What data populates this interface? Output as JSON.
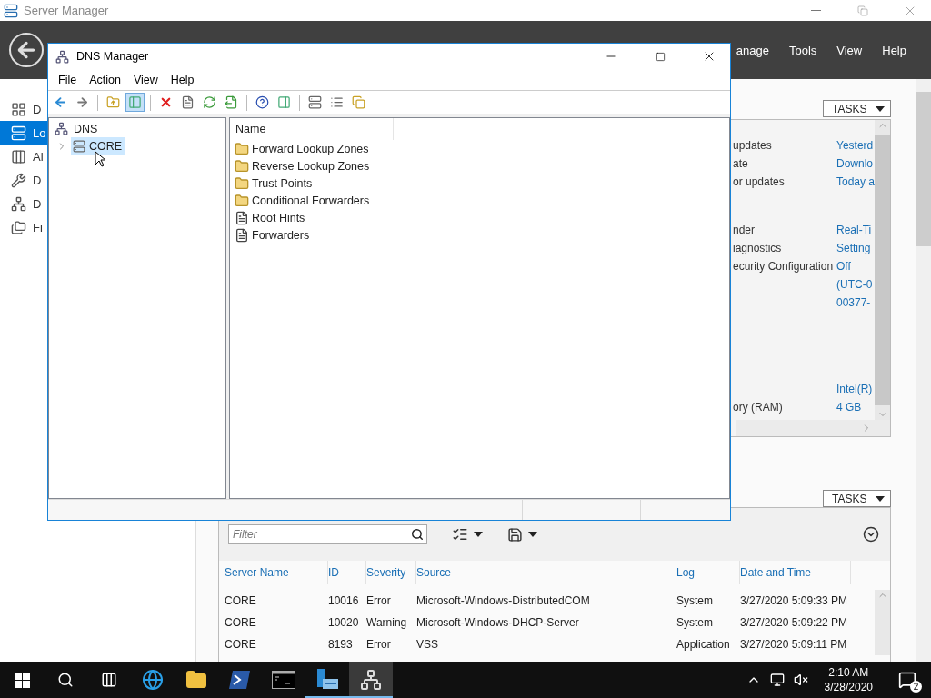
{
  "server_manager": {
    "title": "Server Manager",
    "nav_menu": [
      "anage",
      "Tools",
      "View",
      "Help"
    ],
    "sidebar": [
      {
        "label": "D",
        "kind": "dashboard",
        "selected": false
      },
      {
        "label": "Lo",
        "kind": "local",
        "selected": true
      },
      {
        "label": "Al",
        "kind": "all",
        "selected": false
      },
      {
        "label": "D",
        "kind": "tools",
        "selected": false
      },
      {
        "label": "D",
        "kind": "dns",
        "selected": false
      },
      {
        "label": "Fi",
        "kind": "files",
        "selected": false
      }
    ],
    "properties": {
      "tasks_button": "TASKS",
      "groups": [
        [
          {
            "label": "updates",
            "value": "Yesterd"
          },
          {
            "label": "ate",
            "value": "Downlo"
          },
          {
            "label": "or updates",
            "value": "Today a"
          }
        ],
        [
          {
            "label": "nder",
            "value": "Real-Ti"
          },
          {
            "label": "iagnostics",
            "value": "Setting"
          },
          {
            "label": "ecurity Configuration",
            "value": "Off"
          },
          {
            "value": "(UTC-0"
          },
          {
            "value": "00377-"
          }
        ],
        [
          {
            "value": "Intel(R)"
          },
          {
            "label": "ory (RAM)",
            "value": "4 GB"
          }
        ]
      ]
    },
    "events": {
      "tasks_button": "TASKS",
      "filter": {
        "placeholder": "Filter"
      },
      "columns": [
        "Server Name",
        "ID",
        "Severity",
        "Source",
        "Log",
        "Date and Time"
      ],
      "rows": [
        [
          "CORE",
          "10016",
          "Error",
          "Microsoft-Windows-DistributedCOM",
          "System",
          "3/27/2020 5:09:33 PM"
        ],
        [
          "CORE",
          "10020",
          "Warning",
          "Microsoft-Windows-DHCP-Server",
          "System",
          "3/27/2020 5:09:22 PM"
        ],
        [
          "CORE",
          "8193",
          "Error",
          "VSS",
          "Application",
          "3/27/2020 5:09:11 PM"
        ]
      ]
    }
  },
  "dns_manager": {
    "title": "DNS Manager",
    "menu": [
      "File",
      "Action",
      "View",
      "Help"
    ],
    "toolbar": [
      [
        {
          "kind": "back",
          "pressed": false
        },
        {
          "kind": "forward",
          "pressed": false
        }
      ],
      [
        {
          "kind": "up",
          "pressed": false
        },
        {
          "kind": "tree",
          "pressed": true
        }
      ],
      [
        {
          "kind": "delete",
          "pressed": false
        },
        {
          "kind": "properties",
          "pressed": false
        },
        {
          "kind": "refresh",
          "pressed": false
        },
        {
          "kind": "export",
          "pressed": false
        }
      ],
      [
        {
          "kind": "help",
          "pressed": false
        },
        {
          "kind": "action_pane",
          "pressed": false
        }
      ],
      [
        {
          "kind": "server",
          "pressed": false
        },
        {
          "kind": "list",
          "pressed": false
        },
        {
          "kind": "copy",
          "pressed": false
        }
      ]
    ],
    "tree": {
      "label": "DNS",
      "children": [
        {
          "label": "CORE",
          "selected": true,
          "expanded": false
        }
      ]
    },
    "list": {
      "columns": [
        "Name"
      ],
      "items": [
        {
          "label": "Forward Lookup Zones",
          "kind": "folder"
        },
        {
          "label": "Reverse Lookup Zones",
          "kind": "folder"
        },
        {
          "label": "Trust Points",
          "kind": "folder"
        },
        {
          "label": "Conditional Forwarders",
          "kind": "folder"
        },
        {
          "label": "Root Hints",
          "kind": "document"
        },
        {
          "label": "Forwarders",
          "kind": "document"
        }
      ]
    }
  },
  "taskbar": {
    "apps": [
      {
        "kind": "ie",
        "open": false,
        "selected": false
      },
      {
        "kind": "explorer",
        "open": false,
        "selected": false
      },
      {
        "kind": "powershell",
        "open": false,
        "selected": false
      },
      {
        "kind": "cmd",
        "open": false,
        "selected": false
      },
      {
        "kind": "server_manager",
        "open": true,
        "selected": false
      },
      {
        "kind": "dns",
        "open": true,
        "selected": true
      }
    ],
    "time": "2:10 AM",
    "date": "3/28/2020",
    "notifications": "2"
  }
}
